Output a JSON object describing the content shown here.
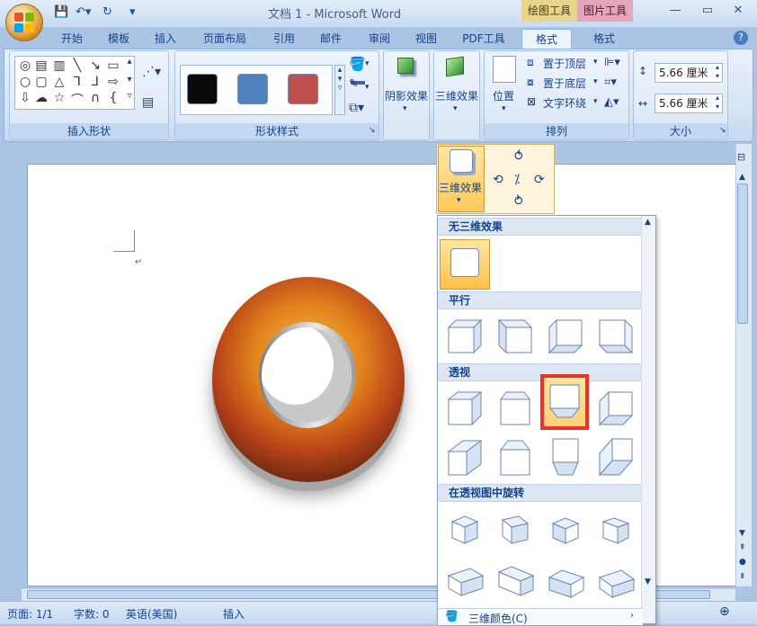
{
  "window": {
    "title": "文档 1 - Microsoft Word"
  },
  "contextual_tabs": {
    "drawing_tools": "绘图工具",
    "picture_tools": "图片工具"
  },
  "tabs": [
    "开始",
    "模板",
    "插入",
    "页面布局",
    "引用",
    "邮件",
    "审阅",
    "视图",
    "PDF工具",
    "格式",
    "格式"
  ],
  "ribbon": {
    "insert_shapes_label": "插入形状",
    "shape_styles_label": "形状样式",
    "shadow_effects": "阴影效果",
    "three_d_effects": "三维效果",
    "position": "位置",
    "bring_to_front": "置于顶层",
    "send_to_back": "置于底层",
    "text_wrapping": "文字环绕",
    "arrange_label": "排列",
    "height_value": "5.66 厘米",
    "width_value": "5.66 厘米",
    "size_label": "大小",
    "swatch_colors": [
      "#0a0a0a",
      "#4f81bd",
      "#c0504d"
    ]
  },
  "dropdown": {
    "button_label": "三维效果",
    "sections": {
      "none": "无三维效果",
      "parallel": "平行",
      "perspective": "透视",
      "rotate_perspective": "在透视图中旋转"
    },
    "footer_item": "三维颜色(C)"
  },
  "status": {
    "page": "页面: 1/1",
    "words": "字数: 0",
    "language": "英语(美国)",
    "insert": "插入"
  }
}
